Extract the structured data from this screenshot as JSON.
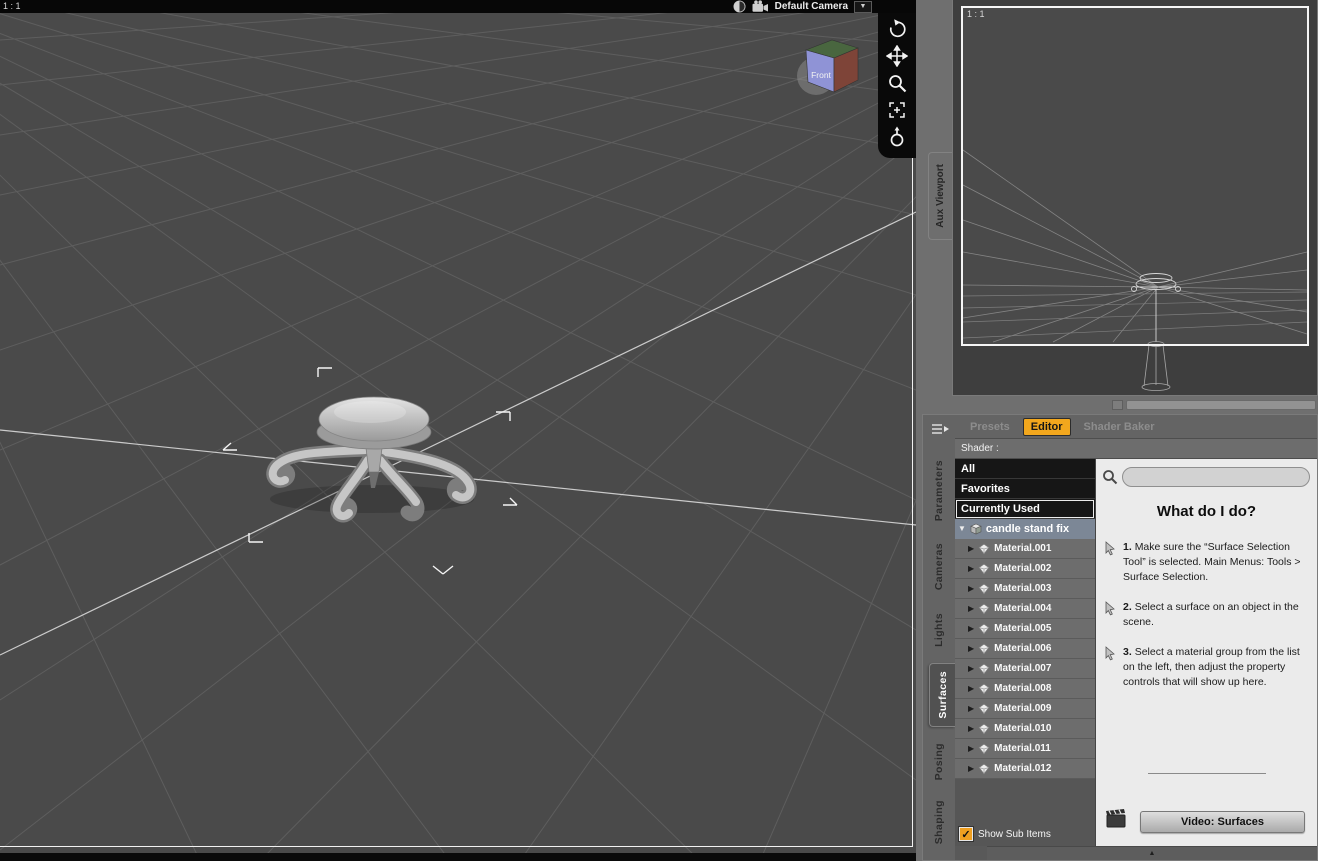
{
  "colors": {
    "accent_orange": "#f2a71d",
    "checkbox_orange": "#ef9f20",
    "selected_item_bg": "#7c8796",
    "viewport_bg": "#4a4a4a"
  },
  "icons": {
    "collapsed_arrow": "▶",
    "expanded_arrow": "▼",
    "dropdown_arrow": "▼",
    "menu": "≡",
    "check": "✓",
    "collapse_up": "▲"
  },
  "main_viewport": {
    "ratio_label": "1 : 1",
    "camera_label": "Default Camera",
    "view_cube_front_label": "Front"
  },
  "aux_viewport": {
    "tab_label": "Aux Viewport",
    "ratio_label": "1 : 1"
  },
  "side_tabs": [
    "Parameters",
    "Cameras",
    "Lights",
    "Surfaces",
    "Posing",
    "Shaping"
  ],
  "surfaces": {
    "tabs": [
      "Presets",
      "Editor",
      "Shader Baker"
    ],
    "active_tab": "Editor",
    "shader_label": "Shader :",
    "filters": [
      "All",
      "Favorites",
      "Currently Used"
    ],
    "root_item": "candle stand fix",
    "materials": [
      "Material.001",
      "Material.002",
      "Material.003",
      "Material.004",
      "Material.005",
      "Material.006",
      "Material.007",
      "Material.008",
      "Material.009",
      "Material.010",
      "Material.011",
      "Material.012"
    ],
    "show_sub_items_label": "Show Sub Items",
    "search_value": "",
    "help": {
      "title": "What do I do?",
      "steps": [
        {
          "num": "1.",
          "text": "Make sure the “Surface Selection Tool” is selected. Main Menus: Tools > Surface Selection."
        },
        {
          "num": "2.",
          "text": "Select a surface on an object in the scene."
        },
        {
          "num": "3.",
          "text": "Select a material group from the list on the left, then adjust the property controls that will show up here."
        }
      ],
      "video_button_label": "Video: Surfaces"
    }
  }
}
